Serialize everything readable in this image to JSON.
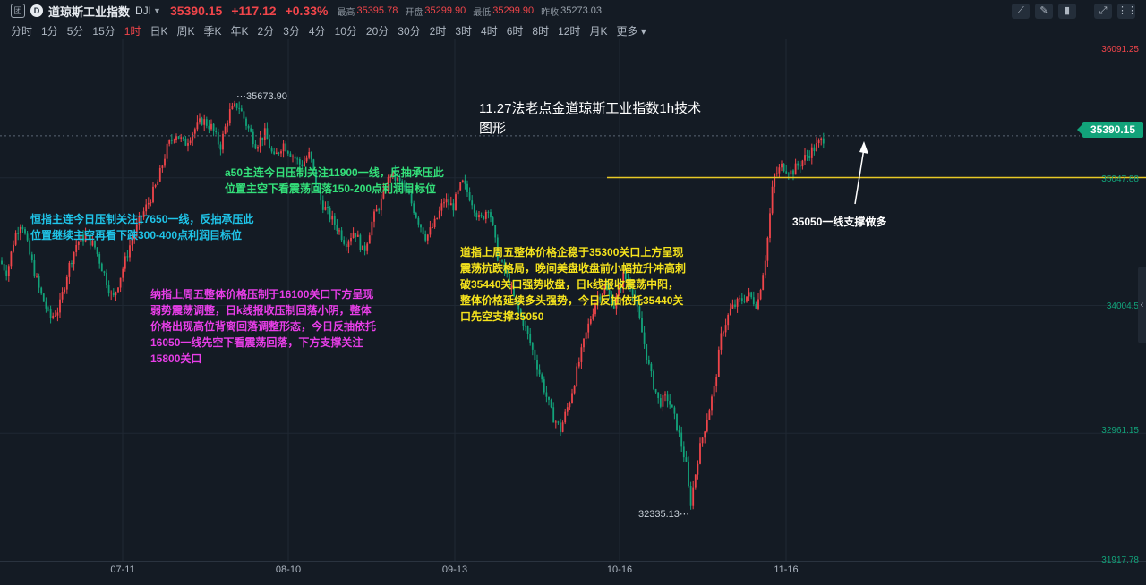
{
  "header": {
    "logo_text": "团",
    "index_name": "道琼斯工业指数",
    "code": "DJI",
    "last": "35390.15",
    "change": "+117.12",
    "change_pct": "+0.33%",
    "high_label": "最高",
    "high": "35395.78",
    "open_label": "开盘",
    "open": "35299.90",
    "low_label": "最低",
    "low": "35299.90",
    "prev_label": "昨收",
    "prev": "35273.03"
  },
  "periods": [
    "分时",
    "1分",
    "5分",
    "15分",
    "1时",
    "日K",
    "周K",
    "季K",
    "年K",
    "2分",
    "3分",
    "4分",
    "10分",
    "20分",
    "30分",
    "2时",
    "3时",
    "4时",
    "6时",
    "8时",
    "12时",
    "月K",
    "更多"
  ],
  "active_period": 4,
  "tools": [
    "trend-line-icon",
    "pencil-icon",
    "trash-icon",
    "expand-icon",
    "grid-icon"
  ],
  "colors": {
    "background": "#141b24",
    "up": "#f0454a",
    "down": "#12a37a",
    "support_line": "#e8c926",
    "price_tag": "#12a37a"
  },
  "chart_data": {
    "type": "candlestick",
    "y_axis_ticks": [
      "36091.25",
      "35047.88",
      "34004.5",
      "32961.15",
      "31917.78"
    ],
    "ylim": [
      31917.78,
      36091.25
    ],
    "x_axis_ticks": [
      "07-11",
      "08-10",
      "09-13",
      "10-16",
      "11-16"
    ],
    "last_price": "35390.15",
    "high_marker": "35673.90",
    "low_marker": "32335.13",
    "support_level": 35050,
    "close_path": [
      [
        0,
        34370
      ],
      [
        8,
        34270
      ],
      [
        16,
        34560
      ],
      [
        24,
        34700
      ],
      [
        32,
        34450
      ],
      [
        44,
        34130
      ],
      [
        56,
        33900
      ],
      [
        66,
        33980
      ],
      [
        76,
        34300
      ],
      [
        86,
        34520
      ],
      [
        96,
        34580
      ],
      [
        106,
        34480
      ],
      [
        116,
        34270
      ],
      [
        126,
        34050
      ],
      [
        136,
        34280
      ],
      [
        146,
        34520
      ],
      [
        156,
        34700
      ],
      [
        166,
        34850
      ],
      [
        176,
        35010
      ],
      [
        186,
        35280
      ],
      [
        196,
        35420
      ],
      [
        206,
        35320
      ],
      [
        216,
        35430
      ],
      [
        226,
        35520
      ],
      [
        236,
        35460
      ],
      [
        246,
        35300
      ],
      [
        256,
        35580
      ],
      [
        266,
        35650
      ],
      [
        276,
        35470
      ],
      [
        286,
        35320
      ],
      [
        296,
        35410
      ],
      [
        306,
        35200
      ],
      [
        316,
        35330
      ],
      [
        326,
        35240
      ],
      [
        336,
        35150
      ],
      [
        346,
        35240
      ],
      [
        356,
        34890
      ],
      [
        366,
        34760
      ],
      [
        376,
        34650
      ],
      [
        386,
        34520
      ],
      [
        396,
        34620
      ],
      [
        406,
        34430
      ],
      [
        416,
        34700
      ],
      [
        426,
        34860
      ],
      [
        436,
        35080
      ],
      [
        446,
        35010
      ],
      [
        456,
        34910
      ],
      [
        466,
        34720
      ],
      [
        476,
        34560
      ],
      [
        486,
        34680
      ],
      [
        496,
        34860
      ],
      [
        506,
        34810
      ],
      [
        516,
        35010
      ],
      [
        526,
        34880
      ],
      [
        536,
        34690
      ],
      [
        546,
        34820
      ],
      [
        556,
        34400
      ],
      [
        566,
        34250
      ],
      [
        576,
        34020
      ],
      [
        586,
        33840
      ],
      [
        596,
        33610
      ],
      [
        606,
        33370
      ],
      [
        616,
        33120
      ],
      [
        626,
        32990
      ],
      [
        636,
        33220
      ],
      [
        646,
        33520
      ],
      [
        656,
        33810
      ],
      [
        666,
        34060
      ],
      [
        676,
        34150
      ],
      [
        686,
        34000
      ],
      [
        696,
        34250
      ],
      [
        706,
        34150
      ],
      [
        716,
        33820
      ],
      [
        726,
        33460
      ],
      [
        736,
        33210
      ],
      [
        746,
        33250
      ],
      [
        756,
        33020
      ],
      [
        766,
        32720
      ],
      [
        771,
        32370
      ],
      [
        780,
        32780
      ],
      [
        790,
        33100
      ],
      [
        798,
        33330
      ],
      [
        806,
        33780
      ],
      [
        816,
        33970
      ],
      [
        826,
        34040
      ],
      [
        836,
        34090
      ],
      [
        846,
        34010
      ],
      [
        856,
        34450
      ],
      [
        864,
        35050
      ],
      [
        874,
        35150
      ],
      [
        884,
        35090
      ],
      [
        894,
        35170
      ],
      [
        904,
        35250
      ],
      [
        914,
        35320
      ],
      [
        922,
        35390
      ]
    ]
  },
  "annotations": {
    "title": "11.27法老点金道琼斯工业指数1h技术\n图形",
    "support_label": "35050一线支撑做多",
    "hsi": "恒指主连今日压制关注17650一线，反抽承压此\n位置继续主空再看下跌300-400点利润目标位",
    "a50": "a50主连今日压制关注11900一线，反抽承压此\n位置主空下看震荡回落150-200点利润目标位",
    "nasdaq": "纳指上周五整体价格压制于16100关口下方呈现\n弱势震荡调整，日k线报收压制回落小阴，整体\n价格出现高位背离回落调整形态，今日反抽依托\n16050一线先空下看震荡回落，下方支撑关注\n15800关口",
    "dow": "道指上周五整体价格企稳于35300关口上方呈现\n震荡抗跌格局，晚间美盘收盘前小幅拉升冲高刺\n破35440关口强势收盘，日k线报收震荡中阳，\n整体价格延续多头强势，今日反抽依托35440关\n口先空支撑35050"
  }
}
